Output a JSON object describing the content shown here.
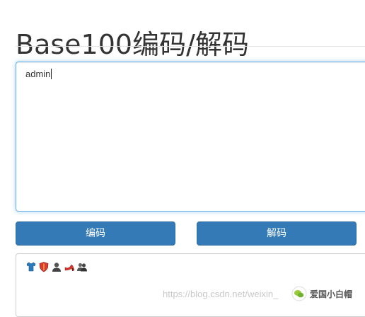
{
  "page": {
    "title": "Base100编码/解码"
  },
  "input": {
    "value": "admin"
  },
  "buttons": {
    "encode_label": "编码",
    "decode_label": "解码"
  },
  "output": {
    "emojis": [
      "shirt-icon",
      "shield-icon",
      "bust-icon",
      "high-heel-icon",
      "busts-icon"
    ]
  },
  "watermark": {
    "url_text": "https://blog.csdn.net/weixin_",
    "name": "爱国小白帽"
  },
  "colors": {
    "primary_button": "#337ab7",
    "focus_border": "#66afe9"
  }
}
